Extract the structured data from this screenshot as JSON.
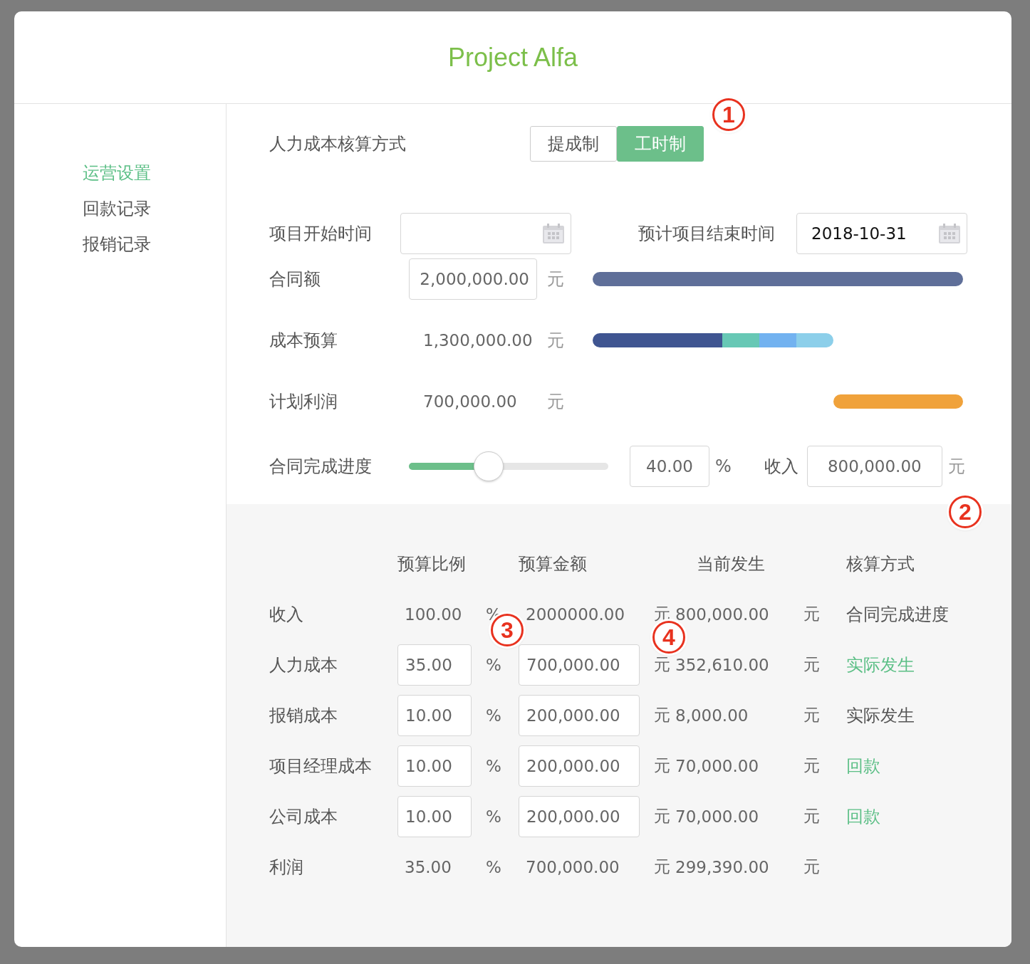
{
  "dialog": {
    "title": "Project Alfa"
  },
  "sidebar": {
    "items": [
      {
        "label": "运营设置",
        "selected": true
      },
      {
        "label": "回款记录",
        "selected": false
      },
      {
        "label": "报销记录",
        "selected": false
      }
    ]
  },
  "labor_cost_method": {
    "label": "人力成本核算方式",
    "options": [
      {
        "label": "提成制",
        "selected": false
      },
      {
        "label": "工时制",
        "selected": true
      }
    ]
  },
  "start_date": {
    "label": "项目开始时间"
  },
  "end_date": {
    "label": "预计项目结束时间",
    "value": "2018-10-31"
  },
  "contract_amount": {
    "label": "合同额",
    "value": "2,000,000.00",
    "unit": "元"
  },
  "cost_budget": {
    "label": "成本预算",
    "value": "1,300,000.00",
    "unit": "元",
    "segments": [
      {
        "color": "#3f5591"
      },
      {
        "color": "#67c8b5"
      },
      {
        "color": "#72b2f0"
      },
      {
        "color": "#8ccfea"
      }
    ]
  },
  "planned_profit": {
    "label": "计划利润",
    "value": "700,000.00",
    "unit": "元"
  },
  "progress": {
    "label": "合同完成进度",
    "level": 0.4,
    "value": "40.00",
    "unit": "%",
    "income_label": "收入",
    "income_value": "800,000.00",
    "income_unit": "元"
  },
  "table": {
    "columns": [
      "预算比例",
      "预算金额",
      "当前发生",
      "核算方式"
    ],
    "rows": [
      {
        "label": "收入",
        "ratio": "100.00",
        "ratio_editable": false,
        "ratio_unit": "%",
        "amount": "2000000.00",
        "amount_editable": false,
        "amount_unit": "元",
        "current": "800,000.00",
        "current_unit": "元",
        "method": "合同完成进度",
        "method_highlight": false
      },
      {
        "label": "人力成本",
        "ratio": "35.00",
        "ratio_editable": true,
        "ratio_unit": "%",
        "amount": "700,000.00",
        "amount_editable": true,
        "amount_unit": "元",
        "current": "352,610.00",
        "current_unit": "元",
        "method": "实际发生",
        "method_highlight": true
      },
      {
        "label": "报销成本",
        "ratio": "10.00",
        "ratio_editable": true,
        "ratio_unit": "%",
        "amount": "200,000.00",
        "amount_editable": true,
        "amount_unit": "元",
        "current": "8,000.00",
        "current_unit": "元",
        "method": "实际发生",
        "method_highlight": false
      },
      {
        "label": "项目经理成本",
        "ratio": "10.00",
        "ratio_editable": true,
        "ratio_unit": "%",
        "amount": "200,000.00",
        "amount_editable": true,
        "amount_unit": "元",
        "current": "70,000.00",
        "current_unit": "元",
        "method": "回款",
        "method_highlight": true
      },
      {
        "label": "公司成本",
        "ratio": "10.00",
        "ratio_editable": true,
        "ratio_unit": "%",
        "amount": "200,000.00",
        "amount_editable": true,
        "amount_unit": "元",
        "current": "70,000.00",
        "current_unit": "元",
        "method": "回款",
        "method_highlight": true
      },
      {
        "label": "利润",
        "ratio": "35.00",
        "ratio_editable": false,
        "ratio_unit": "%",
        "amount": "700,000.00",
        "amount_editable": false,
        "amount_unit": "元",
        "current": "299,390.00",
        "current_unit": "元"
      }
    ]
  },
  "callouts": [
    "1",
    "2",
    "3",
    "4"
  ]
}
